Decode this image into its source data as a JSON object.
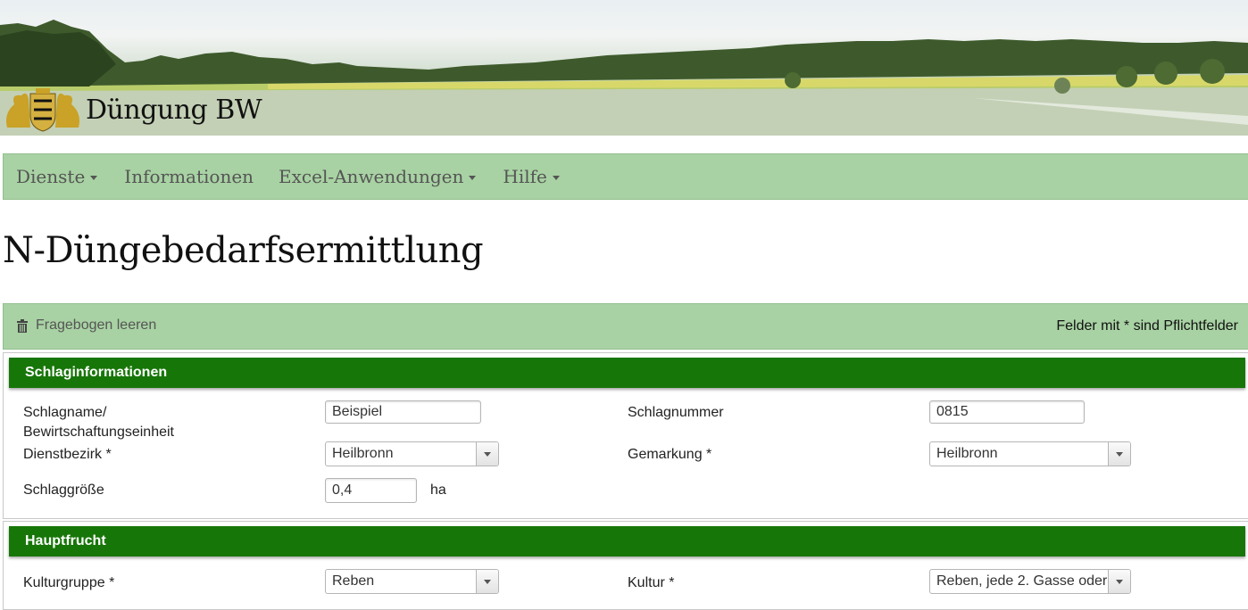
{
  "app": {
    "title": "Düngung BW"
  },
  "nav": {
    "items": [
      {
        "label": "Dienste",
        "has_dropdown": true
      },
      {
        "label": "Informationen",
        "has_dropdown": false
      },
      {
        "label": "Excel-Anwendungen",
        "has_dropdown": true
      },
      {
        "label": "Hilfe",
        "has_dropdown": true
      }
    ]
  },
  "page": {
    "title": "N-Düngebedarfsermittlung"
  },
  "toolbar": {
    "clear_label": "Fragebogen leeren",
    "clear_icon": "trash-icon",
    "required_note": "Felder mit * sind Pflichtfelder"
  },
  "sections": {
    "schlag": {
      "title": "Schlaginformationen",
      "name_label": "Schlagname/",
      "name_label2": "Bewirtschaftungseinheit",
      "name_value": "Beispiel",
      "number_label": "Schlagnummer",
      "number_value": "0815",
      "district_label": "Dienstbezirk *",
      "district_value": "Heilbronn",
      "gemarkung_label": "Gemarkung *",
      "gemarkung_value": "Heilbronn",
      "size_label": "Schlaggröße",
      "size_value": "0,4",
      "size_unit": "ha"
    },
    "haupt": {
      "title": "Hauptfrucht",
      "group_label": "Kulturgruppe *",
      "group_value": "Reben",
      "culture_label": "Kultur *",
      "culture_value": "Reben, jede 2. Gasse oder"
    }
  },
  "colors": {
    "nav_bg": "#a8d2a3",
    "section_head": "#177608"
  }
}
